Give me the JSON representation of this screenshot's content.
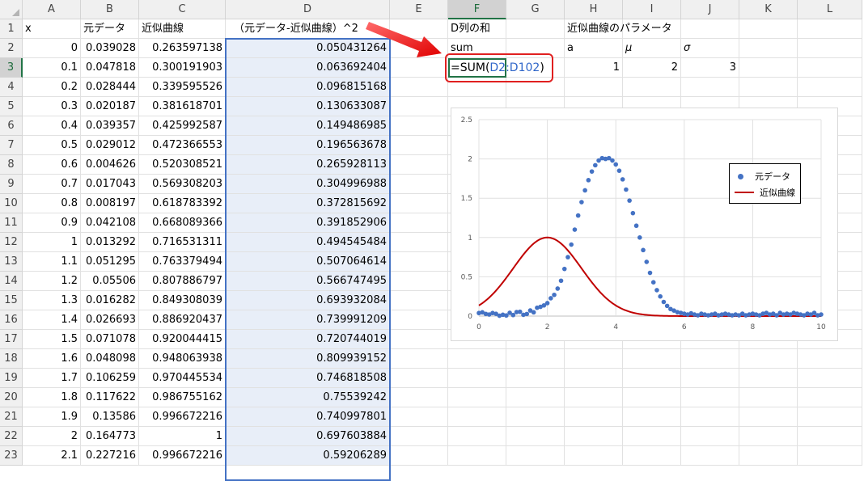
{
  "columns": [
    "A",
    "B",
    "C",
    "D",
    "E",
    "F",
    "G",
    "H",
    "I",
    "J",
    "K",
    "L"
  ],
  "rows": [
    "1",
    "2",
    "3",
    "4",
    "5",
    "6",
    "7",
    "8",
    "9",
    "10",
    "11",
    "12",
    "13",
    "14",
    "15",
    "16",
    "17",
    "18",
    "19",
    "20",
    "21",
    "22",
    "23"
  ],
  "headers": {
    "x": "x",
    "original": "元データ",
    "approx": "近似曲線",
    "diff_sq": "（元データ-近似曲線）^2"
  },
  "table": [
    [
      "0",
      "0.039028",
      "0.263597138",
      "0.050431264"
    ],
    [
      "0.1",
      "0.047818",
      "0.300191903",
      "0.063692404"
    ],
    [
      "0.2",
      "0.028444",
      "0.339595526",
      "0.096815168"
    ],
    [
      "0.3",
      "0.020187",
      "0.381618701",
      "0.130633087"
    ],
    [
      "0.4",
      "0.039357",
      "0.425992587",
      "0.149486985"
    ],
    [
      "0.5",
      "0.029012",
      "0.472366553",
      "0.196563678"
    ],
    [
      "0.6",
      "0.004626",
      "0.520308521",
      "0.265928113"
    ],
    [
      "0.7",
      "0.017043",
      "0.569308203",
      "0.304996988"
    ],
    [
      "0.8",
      "0.008197",
      "0.618783392",
      "0.372815692"
    ],
    [
      "0.9",
      "0.042108",
      "0.668089366",
      "0.391852906"
    ],
    [
      "1",
      "0.013292",
      "0.716531311",
      "0.494545484"
    ],
    [
      "1.1",
      "0.051295",
      "0.763379494",
      "0.507064614"
    ],
    [
      "1.2",
      "0.05506",
      "0.807886797",
      "0.566747495"
    ],
    [
      "1.3",
      "0.016282",
      "0.849308039",
      "0.693932084"
    ],
    [
      "1.4",
      "0.026693",
      "0.886920437",
      "0.739991209"
    ],
    [
      "1.5",
      "0.071078",
      "0.920044415",
      "0.720744019"
    ],
    [
      "1.6",
      "0.048098",
      "0.948063938",
      "0.809939152"
    ],
    [
      "1.7",
      "0.106259",
      "0.970445534",
      "0.746818508"
    ],
    [
      "1.8",
      "0.117622",
      "0.986755162",
      "0.75539242"
    ],
    [
      "1.9",
      "0.13586",
      "0.996672216",
      "0.740997801"
    ],
    [
      "2",
      "0.164773",
      "1",
      "0.697603884"
    ],
    [
      "2.1",
      "0.227216",
      "0.996672216",
      "0.59206289"
    ]
  ],
  "sum_section": {
    "title": "D列の和",
    "label": "sum",
    "formula_prefix": "=SUM(",
    "formula_ref": "D2:D102",
    "formula_suffix": ")"
  },
  "params": {
    "title": "近似曲線のパラメータ",
    "labels": [
      "a",
      "μ",
      "σ"
    ],
    "values": [
      "1",
      "2",
      "3"
    ]
  },
  "chart_data": {
    "type": "scatter",
    "xlim": [
      0,
      10
    ],
    "ylim": [
      0,
      2.5
    ],
    "xticks": [
      "0",
      "2",
      "4",
      "6",
      "8",
      "10"
    ],
    "yticks": [
      "0",
      "0.5",
      "1",
      "1.5",
      "2",
      "2.5"
    ],
    "grid": true,
    "legend": "right",
    "series": [
      {
        "name": "元データ",
        "kind": "scatter",
        "color": "#4472c4",
        "x": [
          0,
          0.1,
          0.2,
          0.3,
          0.4,
          0.5,
          0.6,
          0.7,
          0.8,
          0.9,
          1,
          1.1,
          1.2,
          1.3,
          1.4,
          1.5,
          1.6,
          1.7,
          1.8,
          1.9,
          2,
          2.1,
          2.2,
          2.3,
          2.4,
          2.5,
          2.6,
          2.7,
          2.8,
          2.9,
          3,
          3.1,
          3.2,
          3.3,
          3.4,
          3.5,
          3.6,
          3.7,
          3.8,
          3.9,
          4,
          4.1,
          4.2,
          4.3,
          4.4,
          4.5,
          4.6,
          4.7,
          4.8,
          4.9,
          5,
          5.1,
          5.2,
          5.3,
          5.4,
          5.5,
          5.6,
          5.7,
          5.8,
          5.9,
          6,
          6.1,
          6.2,
          6.3,
          6.4,
          6.5,
          6.6,
          6.7,
          6.8,
          6.9,
          7,
          7.1,
          7.2,
          7.3,
          7.4,
          7.5,
          7.6,
          7.7,
          7.8,
          7.9,
          8,
          8.1,
          8.2,
          8.3,
          8.4,
          8.5,
          8.6,
          8.7,
          8.8,
          8.9,
          9,
          9.1,
          9.2,
          9.3,
          9.4,
          9.5,
          9.6,
          9.7,
          9.8,
          9.9,
          10
        ],
        "y": [
          0.039,
          0.048,
          0.028,
          0.02,
          0.039,
          0.029,
          0.005,
          0.017,
          0.008,
          0.042,
          0.013,
          0.051,
          0.055,
          0.016,
          0.027,
          0.071,
          0.048,
          0.106,
          0.118,
          0.136,
          0.165,
          0.227,
          0.27,
          0.35,
          0.45,
          0.6,
          0.75,
          0.91,
          1.1,
          1.28,
          1.45,
          1.6,
          1.73,
          1.84,
          1.92,
          1.98,
          2.01,
          2.0,
          2.01,
          1.98,
          1.93,
          1.85,
          1.74,
          1.61,
          1.47,
          1.31,
          1.15,
          1.0,
          0.84,
          0.69,
          0.55,
          0.43,
          0.33,
          0.25,
          0.18,
          0.13,
          0.09,
          0.07,
          0.05,
          0.04,
          0.03,
          0.02,
          0.035,
          0.02,
          0.01,
          0.03,
          0.02,
          0.01,
          0.02,
          0.03,
          0.01,
          0.02,
          0.03,
          0.02,
          0.01,
          0.02,
          0.01,
          0.03,
          0.01,
          0.02,
          0.03,
          0.02,
          0.01,
          0.03,
          0.04,
          0.02,
          0.03,
          0.01,
          0.04,
          0.02,
          0.03,
          0.02,
          0.04,
          0.03,
          0.02,
          0.01,
          0.03,
          0.02,
          0.04,
          0.01,
          0.02
        ]
      },
      {
        "name": "近似曲線",
        "kind": "line",
        "color": "#c00000",
        "a": 1,
        "mu": 2,
        "sigma": 1
      }
    ]
  }
}
